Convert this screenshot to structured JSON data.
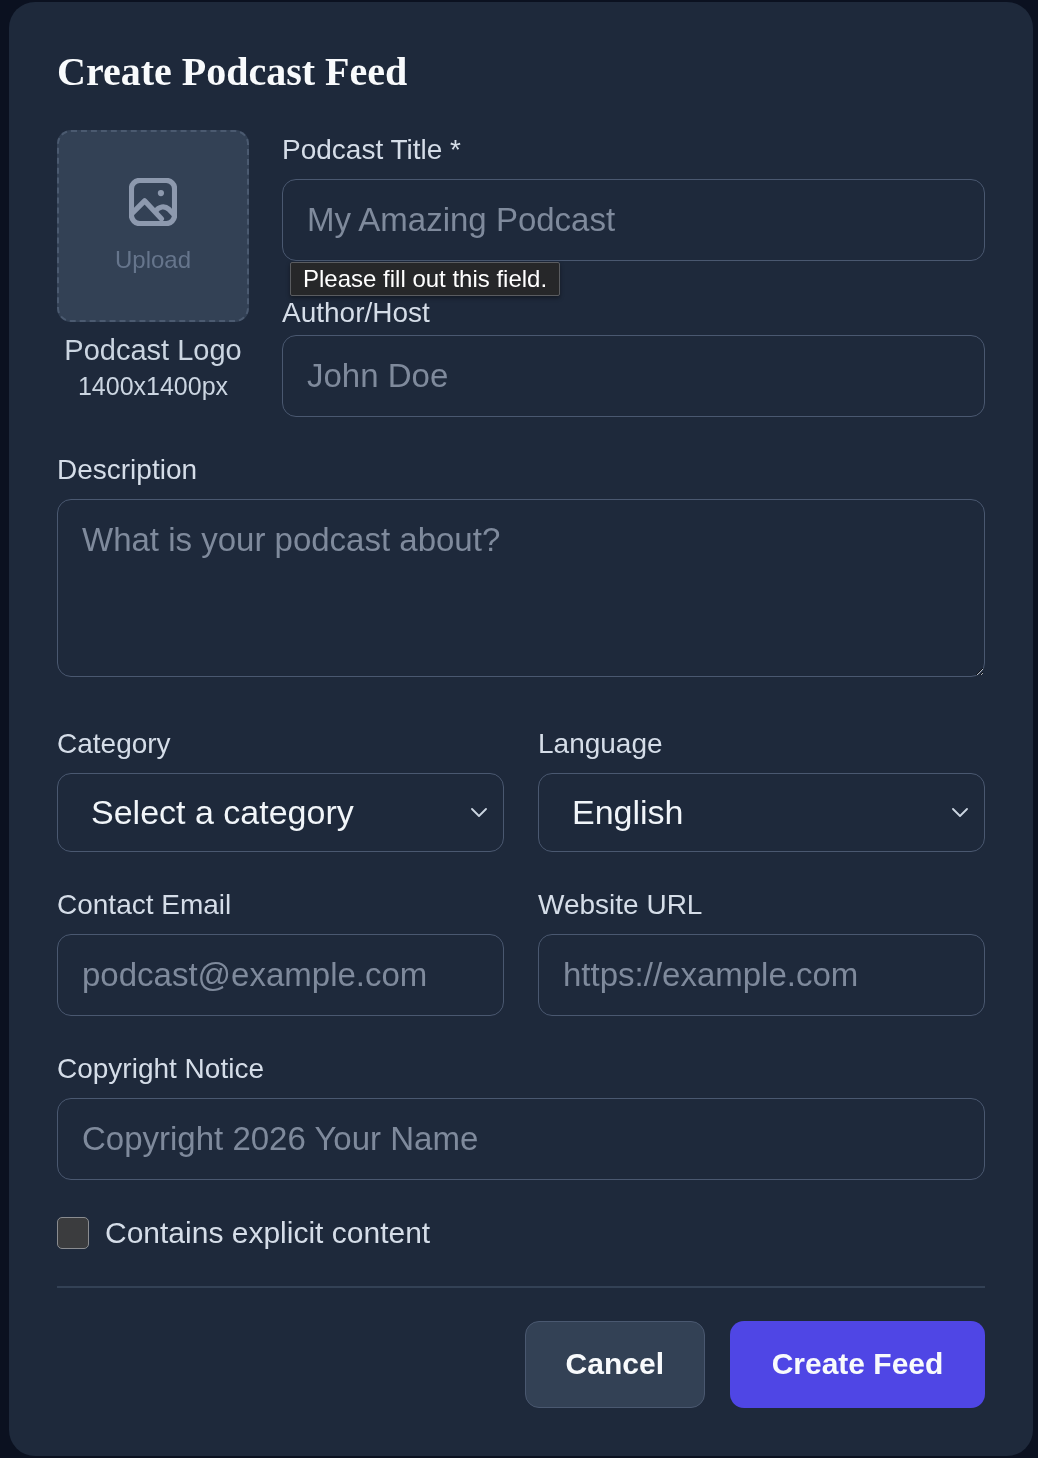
{
  "dialog": {
    "title": "Create Podcast Feed"
  },
  "logo_upload": {
    "button_label": "Upload",
    "caption": "Podcast Logo",
    "size_hint": "1400x1400px"
  },
  "title_field": {
    "label": "Podcast Title *",
    "placeholder": "My Amazing Podcast"
  },
  "validation_tooltip": {
    "text": "Please fill out this field."
  },
  "author_field": {
    "label": "Author/Host",
    "placeholder": "John Doe"
  },
  "description_field": {
    "label": "Description",
    "placeholder": "What is your podcast about?"
  },
  "category_field": {
    "label": "Category",
    "value": "Select a category"
  },
  "language_field": {
    "label": "Language",
    "value": "English"
  },
  "email_field": {
    "label": "Contact Email",
    "placeholder": "podcast@example.com"
  },
  "website_field": {
    "label": "Website URL",
    "placeholder": "https://example.com"
  },
  "copyright_field": {
    "label": "Copyright Notice",
    "placeholder": "Copyright 2026 Your Name"
  },
  "explicit_checkbox": {
    "label": "Contains explicit content",
    "checked": false
  },
  "buttons": [
    {
      "label": "Cancel",
      "kind": "secondary"
    },
    {
      "label": "Create Feed",
      "kind": "primary"
    }
  ]
}
